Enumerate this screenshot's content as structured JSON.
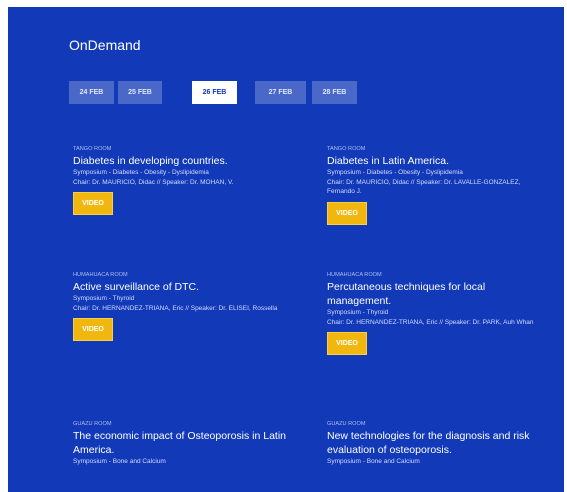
{
  "header": {
    "title": "OnDemand"
  },
  "tabs": [
    {
      "label": "24 FEB",
      "active": false
    },
    {
      "label": "25 FEB",
      "active": false
    },
    {
      "label": "26 FEB",
      "active": true
    },
    {
      "label": "27 FEB",
      "active": false
    },
    {
      "label": "28 FEB",
      "active": false
    }
  ],
  "events": [
    {
      "room": "TANGO ROOM",
      "title": "Diabetes in developing countries.",
      "tags": "Symposium - Diabetes - Obesity - Dyslipidemia",
      "speakers": "Chair: Dr. MAURICIO, Didac // Speaker: Dr. MOHAN, V.",
      "video_label": "VIDEO"
    },
    {
      "room": "TANGO ROOM",
      "title": "Diabetes in Latin America.",
      "tags": "Symposium - Diabetes - Obesity - Dyslipidemia",
      "speakers": "Chair: Dr. MAURICIO, Didac // Speaker: Dr. LAVALLE-GONZALEZ, Fernando J.",
      "video_label": "VIDEO"
    },
    {
      "room": "HUMAHUACA ROOM",
      "title": "Active surveillance of DTC.",
      "tags": "Symposium - Thyroid",
      "speakers": "Chair: Dr. HERNANDEZ-TRIANA, Eric // Speaker: Dr. ELISEI, Rossella",
      "video_label": "VIDEO"
    },
    {
      "room": "HUMAHUACA ROOM",
      "title": "Percutaneous techniques for local management.",
      "tags": "Symposium - Thyroid",
      "speakers": "Chair: Dr. HERNANDEZ-TRIANA, Eric // Speaker: Dr. PARK, Auh Whan",
      "video_label": "VIDEO"
    },
    {
      "room": "GUAZU ROOM",
      "title": "The economic impact of Osteoporosis in Latin America.",
      "tags": "Symposium - Bone and Calcium",
      "speakers": "",
      "video_label": ""
    },
    {
      "room": "GUAZU ROOM",
      "title": "New technologies for the diagnosis and risk evaluation of osteoporosis.",
      "tags": "Symposium - Bone and Calcium",
      "speakers": "",
      "video_label": ""
    }
  ],
  "colors": {
    "panel_bg": "#1239b8",
    "tab_bg": "#4a68c8",
    "tab_active_bg": "#ffffff",
    "video_button": "#f2b70f"
  }
}
